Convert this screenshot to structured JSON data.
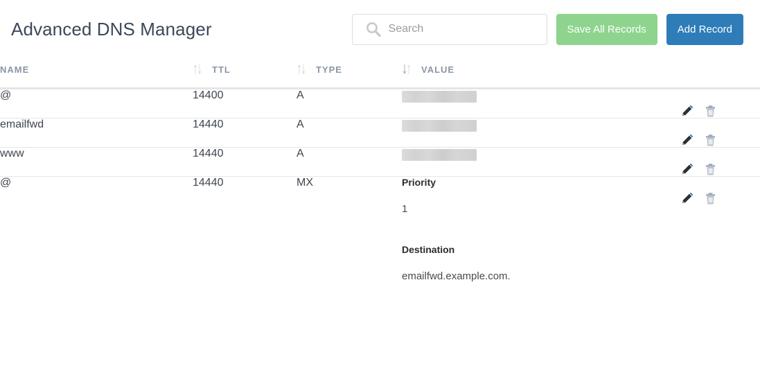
{
  "header": {
    "title": "Advanced DNS Manager",
    "search": {
      "placeholder": "Search",
      "value": "",
      "icon": "search-icon"
    },
    "save_button": {
      "label": "Save All Records",
      "color": "#8ed48e",
      "state": "disabled"
    },
    "add_button": {
      "label": "Add Record",
      "color": "#2e7cb8"
    }
  },
  "table": {
    "columns": [
      {
        "key": "name",
        "label": "NAME",
        "sortable": true,
        "sort_state": "none",
        "sort_icon": "sort-updown-icon"
      },
      {
        "key": "ttl",
        "label": "TTL",
        "sortable": true,
        "sort_state": "none",
        "sort_icon": "sort-updown-icon"
      },
      {
        "key": "type",
        "label": "TYPE",
        "sortable": true,
        "sort_state": "desc",
        "sort_icon": "sort-desc-icon"
      },
      {
        "key": "value",
        "label": "VALUE",
        "sortable": false,
        "sort_state": "none",
        "sort_icon": ""
      },
      {
        "key": "actions",
        "label": "",
        "sortable": false,
        "sort_state": "none",
        "sort_icon": ""
      }
    ],
    "rows": [
      {
        "name": "@",
        "ttl": "14400",
        "type": "A",
        "value_kind": "redacted",
        "value": "",
        "actions": {
          "edit": "edit-icon",
          "delete": "delete-icon"
        }
      },
      {
        "name": "emailfwd",
        "ttl": "14440",
        "type": "A",
        "value_kind": "redacted",
        "value": "",
        "actions": {
          "edit": "edit-icon",
          "delete": "delete-icon"
        }
      },
      {
        "name": "www",
        "ttl": "14440",
        "type": "A",
        "value_kind": "redacted",
        "value": "",
        "actions": {
          "edit": "edit-icon",
          "delete": "delete-icon"
        }
      },
      {
        "name": "@",
        "ttl": "14440",
        "type": "MX",
        "value_kind": "fields",
        "fields": [
          {
            "label": "Priority",
            "value": "1"
          },
          {
            "label": "Destination",
            "value": "emailfwd.example.com."
          }
        ],
        "actions": {
          "edit": "edit-icon",
          "delete": "delete-icon"
        }
      }
    ]
  },
  "colors": {
    "title": "#3c4858",
    "header_text": "#8a95a5",
    "row_text": "#3f4650",
    "divider": "#e6e6e6",
    "redaction": "#d4d4d4"
  }
}
